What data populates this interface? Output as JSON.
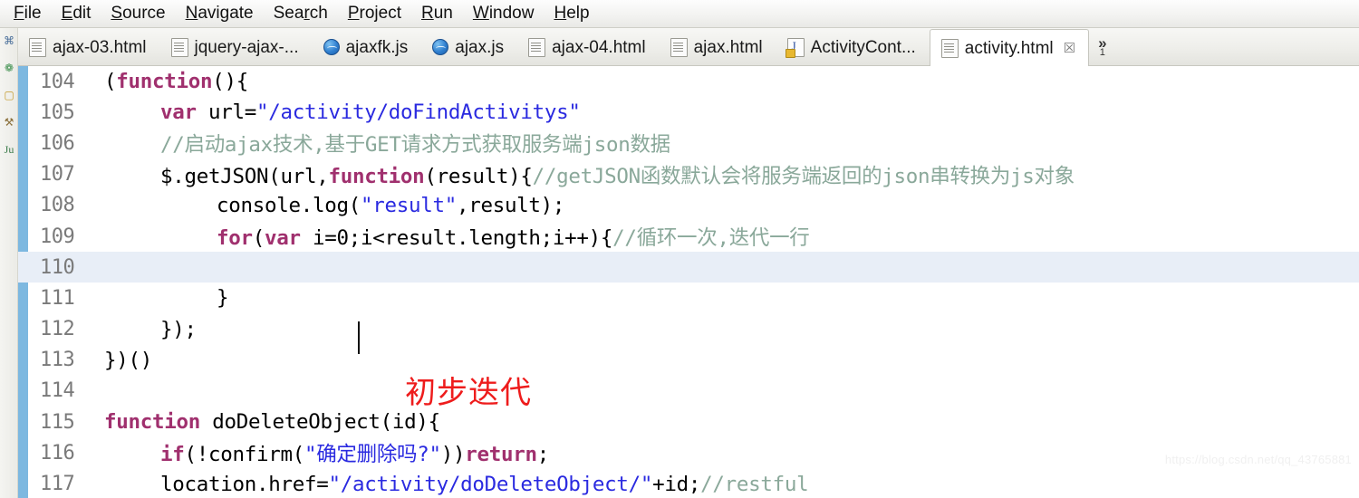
{
  "menu": {
    "items": [
      {
        "label": "File",
        "mnemonic_index": 0
      },
      {
        "label": "Edit",
        "mnemonic_index": 0
      },
      {
        "label": "Source",
        "mnemonic_index": 0
      },
      {
        "label": "Navigate",
        "mnemonic_index": 0
      },
      {
        "label": "Search",
        "mnemonic_index": 3
      },
      {
        "label": "Project",
        "mnemonic_index": 0
      },
      {
        "label": "Run",
        "mnemonic_index": 0
      },
      {
        "label": "Window",
        "mnemonic_index": 0
      },
      {
        "label": "Help",
        "mnemonic_index": 0
      }
    ]
  },
  "tabs": {
    "items": [
      {
        "label": "ajax-03.html",
        "icon": "html-file-icon",
        "active": false,
        "closable": false
      },
      {
        "label": "jquery-ajax-...",
        "icon": "html-file-icon",
        "active": false,
        "closable": false
      },
      {
        "label": "ajaxfk.js",
        "icon": "js-file-icon",
        "active": false,
        "closable": false
      },
      {
        "label": "ajax.js",
        "icon": "js-file-icon",
        "active": false,
        "closable": false
      },
      {
        "label": "ajax-04.html",
        "icon": "html-file-icon",
        "active": false,
        "closable": false
      },
      {
        "label": "ajax.html",
        "icon": "html-file-icon",
        "active": false,
        "closable": false
      },
      {
        "label": "ActivityCont...",
        "icon": "java-file-icon",
        "active": false,
        "closable": false
      },
      {
        "label": "activity.html",
        "icon": "html-file-icon",
        "active": true,
        "closable": true
      }
    ],
    "close_glyph": "☒",
    "overflow_chevron": "»",
    "overflow_count": "1"
  },
  "toolstrip": {
    "icons": [
      "outline-icon",
      "palette-icon",
      "folder-icon",
      "wrench-icon",
      "junit-icon"
    ],
    "glyphs": [
      "⌘",
      "❁",
      "▢",
      "⚒",
      "Ju"
    ]
  },
  "editor": {
    "first_line_number": 104,
    "current_line": 110,
    "caret_line": 110,
    "lines": [
      {
        "n": "104",
        "indent": 0,
        "tokens": [
          {
            "t": "plain",
            "s": "("
          },
          {
            "t": "kw",
            "s": "function"
          },
          {
            "t": "plain",
            "s": "(){"
          }
        ]
      },
      {
        "n": "105",
        "indent": 1,
        "tokens": [
          {
            "t": "kw",
            "s": "var"
          },
          {
            "t": "plain",
            "s": " url="
          },
          {
            "t": "str",
            "s": "\"/activity/doFindActivitys\""
          }
        ]
      },
      {
        "n": "106",
        "indent": 1,
        "tokens": [
          {
            "t": "cmt",
            "s": "//启动ajax技术,基于GET请求方式获取服务端json数据"
          }
        ]
      },
      {
        "n": "107",
        "indent": 1,
        "tokens": [
          {
            "t": "plain",
            "s": "$.getJSON(url,"
          },
          {
            "t": "kw",
            "s": "function"
          },
          {
            "t": "plain",
            "s": "(result){"
          },
          {
            "t": "cmt",
            "s": "//getJSON函数默认会将服务端返回的json串转换为js对象"
          }
        ]
      },
      {
        "n": "108",
        "indent": 2,
        "tokens": [
          {
            "t": "plain",
            "s": "console.log("
          },
          {
            "t": "str",
            "s": "\"result\""
          },
          {
            "t": "plain",
            "s": ",result);"
          }
        ]
      },
      {
        "n": "109",
        "indent": 2,
        "tokens": [
          {
            "t": "kw",
            "s": "for"
          },
          {
            "t": "plain",
            "s": "("
          },
          {
            "t": "kw",
            "s": "var"
          },
          {
            "t": "plain",
            "s": " i=0;i<result.length;i++){"
          },
          {
            "t": "cmt",
            "s": "//循环一次,迭代一行"
          }
        ]
      },
      {
        "n": "110",
        "indent": 0,
        "tokens": []
      },
      {
        "n": "111",
        "indent": 2,
        "tokens": [
          {
            "t": "plain",
            "s": "}"
          }
        ]
      },
      {
        "n": "112",
        "indent": 1,
        "tokens": [
          {
            "t": "plain",
            "s": "});"
          }
        ]
      },
      {
        "n": "113",
        "indent": 0,
        "tokens": [
          {
            "t": "plain",
            "s": "})()"
          }
        ]
      },
      {
        "n": "114",
        "indent": 0,
        "tokens": []
      },
      {
        "n": "115",
        "indent": 0,
        "tokens": [
          {
            "t": "kw",
            "s": "function"
          },
          {
            "t": "plain",
            "s": " doDeleteObject(id){"
          }
        ]
      },
      {
        "n": "116",
        "indent": 1,
        "tokens": [
          {
            "t": "kw",
            "s": "if"
          },
          {
            "t": "plain",
            "s": "(!confirm("
          },
          {
            "t": "str",
            "s": "\"确定删除吗?\""
          },
          {
            "t": "plain",
            "s": "))"
          },
          {
            "t": "kw",
            "s": "return"
          },
          {
            "t": "plain",
            "s": ";"
          }
        ]
      },
      {
        "n": "117",
        "indent": 1,
        "tokens": [
          {
            "t": "plain",
            "s": "location.href="
          },
          {
            "t": "str",
            "s": "\"/activity/doDeleteObject/\""
          },
          {
            "t": "plain",
            "s": "+id;"
          },
          {
            "t": "cmt",
            "s": "//restful"
          }
        ]
      }
    ]
  },
  "annotation": {
    "text": "初步迭代",
    "color": "#ee1c1c"
  },
  "watermark": {
    "text": "https://blog.csdn.net/qq_43765881"
  }
}
